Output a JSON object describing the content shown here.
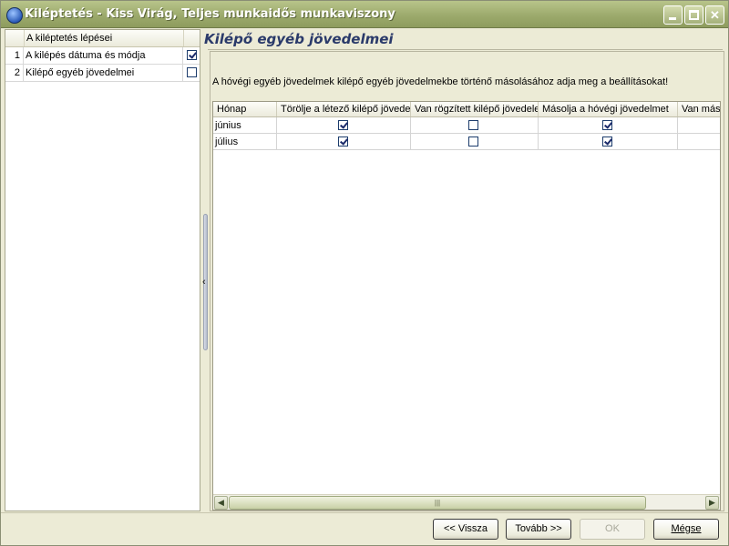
{
  "window": {
    "title": "Kiléptetés - Kiss Virág, Teljes munkaidős munkaviszony"
  },
  "steps": {
    "header": "A kiléptetés lépései",
    "items": [
      {
        "num": "1",
        "label": "A kilépés dátuma és módja",
        "done": true
      },
      {
        "num": "2",
        "label": "Kilépő egyéb jövedelmei",
        "done": false
      }
    ]
  },
  "page": {
    "title": "Kilépő egyéb jövedelmei",
    "description": "A hóvégi egyéb jövedelmek kilépő egyéb jövedelmekbe történő másolásához adja meg a beállításokat!"
  },
  "grid": {
    "columns": [
      "Hónap",
      "Törölje a létező kilépő jövede",
      "Van rögzített kilépő jövedele",
      "Másolja a hóvégi jövedelmet",
      "Van máso"
    ],
    "rows": [
      {
        "month": "június",
        "delete": true,
        "recorded": false,
        "copy": true
      },
      {
        "month": "július",
        "delete": true,
        "recorded": false,
        "copy": true
      }
    ]
  },
  "buttons": {
    "back": "<< Vissza",
    "next": "Tovább >>",
    "ok": "OK",
    "cancel": "Mégse"
  }
}
